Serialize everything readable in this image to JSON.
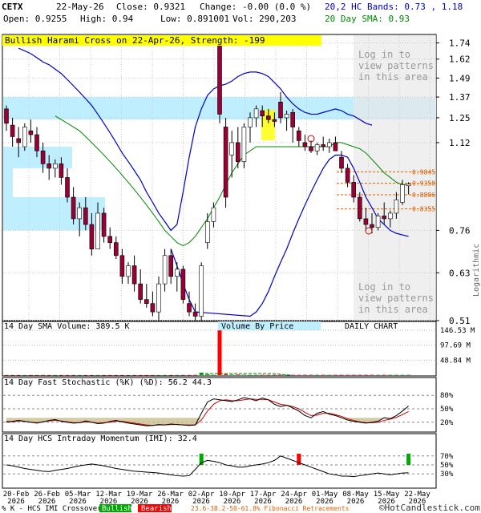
{
  "header": {
    "symbol": "CETX",
    "date": "22-May-26",
    "close": "Close: 0.9321",
    "change": "Change: -0.00 (0.0 %)",
    "open": "Open: 0.9255",
    "high": "High: 0.94",
    "low": "Low: 0.891001",
    "vol": "Vol: 290,203",
    "bands": "20,2 HC Bands: 0.73 , 1.18",
    "sma20": "20 Day SMA: 0.93"
  },
  "pattern_banner": "Bullish Harami Cross on 22-Apr-26, Strength: -199",
  "login_text": [
    "Log in to",
    "view patterns",
    "in this area"
  ],
  "side_label": "Logarithmic",
  "watermark": "©HotCandlestick.com",
  "colors": {
    "band": "#0000cc",
    "sma": "#008800",
    "bull": "#ffffff",
    "bear": "#990033",
    "vbp": "#bfefff",
    "vol_bull": "#00aa00",
    "vol_bear": "#ff0000",
    "stoch_k": "#000000",
    "stoch_d": "#cc0000",
    "fib": "#e06000",
    "highlight": "#ffff00"
  },
  "chart_data": {
    "type": "candlestick",
    "price_axis": {
      "scale": "log",
      "range": [
        0.51,
        1.8
      ],
      "ticks": [
        "1.74",
        "1.62",
        "1.49",
        "1.37",
        "1.25",
        "1.12",
        "0.76",
        "0.63",
        "0.51"
      ]
    },
    "fib_levels": [
      {
        "label": "0.9845",
        "value": 0.9845
      },
      {
        "label": "0.9358",
        "value": 0.9358
      },
      {
        "label": "0.8896",
        "value": 0.8896
      },
      {
        "label": "0.8355",
        "value": 0.8355
      }
    ],
    "x_labels": [
      {
        "label": "20-Feb",
        "year": "2026"
      },
      {
        "label": "26-Feb",
        "year": "2026"
      },
      {
        "label": "05-Mar",
        "year": "2026"
      },
      {
        "label": "12-Mar",
        "year": "2026"
      },
      {
        "label": "19-Mar",
        "year": "2026"
      },
      {
        "label": "26-Mar",
        "year": "2026"
      },
      {
        "label": "02-Apr",
        "year": "2026"
      },
      {
        "label": "10-Apr",
        "year": "2026"
      },
      {
        "label": "17-Apr",
        "year": "2026"
      },
      {
        "label": "24-Apr",
        "year": "2026"
      },
      {
        "label": "01-May",
        "year": "2026"
      },
      {
        "label": "08-May",
        "year": "2026"
      },
      {
        "label": "15-May",
        "year": "2026"
      },
      {
        "label": "22-May",
        "year": "2026"
      }
    ],
    "candles": [
      [
        1.3,
        1.32,
        1.18,
        1.22
      ],
      [
        1.21,
        1.25,
        1.1,
        1.15
      ],
      [
        1.14,
        1.2,
        1.05,
        1.12
      ],
      [
        1.1,
        1.22,
        1.08,
        1.2
      ],
      [
        1.18,
        1.24,
        1.12,
        1.16
      ],
      [
        1.16,
        1.2,
        1.05,
        1.08
      ],
      [
        1.08,
        1.12,
        0.98,
        1.02
      ],
      [
        1.02,
        1.06,
        0.95,
        1.0
      ],
      [
        1.0,
        1.04,
        0.96,
        1.02
      ],
      [
        1.02,
        1.05,
        0.93,
        0.96
      ],
      [
        0.96,
        1.0,
        0.86,
        0.88
      ],
      [
        0.88,
        0.92,
        0.78,
        0.8
      ],
      [
        0.8,
        0.86,
        0.74,
        0.84
      ],
      [
        0.84,
        0.88,
        0.76,
        0.78
      ],
      [
        0.78,
        0.82,
        0.68,
        0.7
      ],
      [
        0.7,
        0.86,
        0.7,
        0.82
      ],
      [
        0.82,
        0.84,
        0.72,
        0.74
      ],
      [
        0.74,
        0.77,
        0.7,
        0.72
      ],
      [
        0.72,
        0.74,
        0.67,
        0.68
      ],
      [
        0.68,
        0.7,
        0.6,
        0.62
      ],
      [
        0.62,
        0.66,
        0.6,
        0.65
      ],
      [
        0.65,
        0.68,
        0.58,
        0.6
      ],
      [
        0.6,
        0.64,
        0.55,
        0.56
      ],
      [
        0.56,
        0.6,
        0.54,
        0.55
      ],
      [
        0.55,
        0.58,
        0.52,
        0.53
      ],
      [
        0.53,
        0.62,
        0.51,
        0.6
      ],
      [
        0.6,
        0.7,
        0.58,
        0.68
      ],
      [
        0.68,
        0.7,
        0.6,
        0.62
      ],
      [
        0.62,
        0.66,
        0.58,
        0.64
      ],
      [
        0.64,
        0.65,
        0.55,
        0.56
      ],
      [
        0.55,
        0.58,
        0.52,
        0.53
      ],
      [
        0.53,
        0.55,
        0.51,
        0.52
      ],
      [
        0.52,
        0.66,
        0.51,
        0.65
      ],
      [
        0.72,
        0.82,
        0.7,
        0.79
      ],
      [
        0.79,
        0.86,
        0.77,
        0.84
      ],
      [
        1.72,
        1.74,
        1.22,
        1.27
      ],
      [
        1.2,
        1.25,
        0.84,
        0.88
      ],
      [
        1.06,
        1.18,
        0.96,
        1.12
      ],
      [
        1.12,
        1.2,
        1.0,
        1.03
      ],
      [
        1.03,
        1.22,
        1.0,
        1.2
      ],
      [
        1.2,
        1.28,
        1.12,
        1.25
      ],
      [
        1.25,
        1.32,
        1.2,
        1.3
      ],
      [
        1.29,
        1.32,
        1.2,
        1.26
      ],
      [
        1.26,
        1.3,
        1.22,
        1.24
      ],
      [
        1.24,
        1.28,
        1.2,
        1.23
      ],
      [
        1.34,
        1.4,
        1.22,
        1.25
      ],
      [
        1.25,
        1.29,
        1.18,
        1.27
      ],
      [
        1.28,
        1.3,
        1.12,
        1.2
      ],
      [
        1.18,
        1.2,
        1.1,
        1.13
      ],
      [
        1.12,
        1.16,
        1.08,
        1.1
      ],
      [
        1.1,
        1.13,
        1.07,
        1.08
      ],
      [
        1.08,
        1.12,
        1.06,
        1.11
      ],
      [
        1.11,
        1.15,
        1.08,
        1.1
      ],
      [
        1.1,
        1.14,
        1.07,
        1.12
      ],
      [
        1.12,
        1.15,
        1.08,
        1.08
      ],
      [
        1.05,
        1.08,
        0.98,
        1.0
      ],
      [
        1.0,
        1.02,
        0.92,
        0.94
      ],
      [
        0.94,
        0.97,
        0.86,
        0.88
      ],
      [
        0.88,
        0.9,
        0.79,
        0.8
      ],
      [
        0.8,
        0.84,
        0.76,
        0.78
      ],
      [
        0.78,
        0.82,
        0.75,
        0.77
      ],
      [
        0.77,
        0.82,
        0.76,
        0.81
      ],
      [
        0.81,
        0.86,
        0.78,
        0.8
      ],
      [
        0.8,
        0.83,
        0.77,
        0.82
      ],
      [
        0.82,
        0.9,
        0.8,
        0.87
      ],
      [
        0.86,
        0.95,
        0.85,
        0.93
      ],
      [
        0.9255,
        0.94,
        0.891001,
        0.9321
      ]
    ],
    "upper_band": [
      1.7,
      1.68,
      1.66,
      1.63,
      1.6,
      1.58,
      1.55,
      1.52,
      1.48,
      1.44,
      1.4,
      1.36,
      1.32,
      1.27,
      1.22,
      1.17,
      1.12,
      1.07,
      1.03,
      0.99,
      0.95,
      0.9,
      0.86,
      0.82,
      0.79,
      0.76,
      0.78,
      0.9,
      1.05,
      1.2,
      1.3,
      1.38,
      1.42,
      1.44,
      1.45,
      1.47,
      1.5,
      1.52,
      1.53,
      1.53,
      1.52,
      1.5,
      1.46,
      1.42,
      1.37,
      1.33,
      1.3,
      1.28,
      1.27,
      1.27,
      1.28,
      1.29,
      1.3,
      1.29,
      1.27,
      1.26,
      1.24,
      1.22,
      1.21
    ],
    "lower_band": [
      0.55,
      0.57,
      0.6,
      0.63,
      0.66,
      0.7,
      0.74,
      0.78,
      0.82,
      0.86,
      0.9,
      0.93,
      0.96,
      0.98,
      0.99,
      0.99,
      0.97,
      0.94,
      0.9,
      0.86,
      0.82,
      0.79,
      0.77,
      0.76,
      0.755,
      0.75
    ],
    "sma": [
      1.26,
      1.24,
      1.22,
      1.2,
      1.18,
      1.15,
      1.12,
      1.09,
      1.06,
      1.03,
      1.0,
      0.97,
      0.94,
      0.91,
      0.88,
      0.85,
      0.82,
      0.79,
      0.76,
      0.74,
      0.72,
      0.71,
      0.72,
      0.74,
      0.77,
      0.8,
      0.84,
      0.88,
      0.93,
      0.98,
      1.02,
      1.06,
      1.08,
      1.1,
      1.1,
      1.1,
      1.1,
      1.1,
      1.1,
      1.1,
      1.1,
      1.1,
      1.1,
      1.1,
      1.1,
      1.1,
      1.12,
      1.12,
      1.11,
      1.1,
      1.09,
      1.07,
      1.04,
      1.01,
      0.98,
      0.96,
      0.94,
      0.93,
      0.93
    ],
    "volume": {
      "title": "14 Day SMA Volume: 389.5 K",
      "ticks": [
        "146.53 M",
        "97.69 M",
        "48.84 M"
      ],
      "vbp_label": "Volume By Price",
      "mode_label": "DAILY CHART",
      "values": [
        0.4,
        0.3,
        0.3,
        0.3,
        0.3,
        0.3,
        0.4,
        0.3,
        0.3,
        0.3,
        0.4,
        0.3,
        0.3,
        0.3,
        0.3,
        0.3,
        0.3,
        0.3,
        0.3,
        0.3,
        0.3,
        0.3,
        0.3,
        0.3,
        0.3,
        0.3,
        0.4,
        0.3,
        0.5,
        0.4,
        0.5,
        0.8,
        8,
        3,
        1,
        146,
        3,
        2,
        2,
        1.5,
        1,
        1,
        1,
        1,
        1,
        1,
        1,
        1,
        1,
        1,
        1,
        1,
        1,
        1,
        1,
        1,
        1,
        1,
        1,
        1,
        1,
        1,
        1,
        1,
        1,
        1,
        1
      ]
    },
    "stochastic": {
      "title": "14 Day Fast Stochastic (%K) (%D): 56.2  44.3",
      "ticks": [
        "80%",
        "50%",
        "20%"
      ],
      "k": [
        20,
        22,
        24,
        22,
        20,
        18,
        21,
        24,
        26,
        22,
        20,
        18,
        19,
        23,
        20,
        17,
        18,
        22,
        24,
        21,
        18,
        16,
        14,
        12,
        13,
        15,
        14,
        16,
        15,
        14,
        13,
        14,
        40,
        65,
        72,
        70,
        68,
        66,
        70,
        75,
        72,
        68,
        74,
        70,
        60,
        55,
        58,
        52,
        45,
        35,
        30,
        40,
        44,
        38,
        35,
        30,
        25,
        22,
        20,
        18,
        20,
        22,
        30,
        28,
        35,
        45,
        56
      ],
      "d": [
        22,
        21,
        23,
        22,
        20,
        19,
        21,
        23,
        24,
        23,
        21,
        19,
        19,
        21,
        20,
        18,
        19,
        20,
        22,
        22,
        20,
        18,
        16,
        14,
        13,
        14,
        14,
        15,
        15,
        14,
        14,
        14,
        25,
        45,
        60,
        68,
        70,
        68,
        68,
        70,
        72,
        71,
        71,
        70,
        65,
        60,
        58,
        55,
        50,
        42,
        35,
        36,
        40,
        40,
        37,
        33,
        28,
        24,
        21,
        19,
        19,
        20,
        24,
        27,
        31,
        37,
        44
      ]
    },
    "momentum": {
      "title": "14 Day HCS Intraday Momentum (IMI): 32.4",
      "ticks": [
        "70%",
        "50%",
        "30%"
      ],
      "values": [
        50,
        48,
        45,
        42,
        40,
        38,
        36,
        35,
        38,
        40,
        42,
        45,
        48,
        50,
        52,
        50,
        48,
        45,
        42,
        40,
        38,
        36,
        35,
        34,
        33,
        32,
        30,
        28,
        26,
        25,
        26,
        40,
        55,
        60,
        58,
        55,
        50,
        48,
        45,
        45,
        48,
        50,
        52,
        55,
        60,
        70,
        65,
        60,
        55,
        50,
        45,
        40,
        35,
        30,
        28,
        25,
        25,
        24,
        26,
        28,
        30,
        32,
        30,
        28,
        30,
        32,
        32.4
      ],
      "bull_markers": [
        32,
        66
      ],
      "bear_markers": [
        48
      ]
    },
    "legend": {
      "crossover": "% K - HCS IMI Crossover:",
      "bullish": "Bullish",
      "bearish": "Bearish",
      "fib": "23.6-38.2-50-61.8% Fibonacci Retracements"
    }
  }
}
